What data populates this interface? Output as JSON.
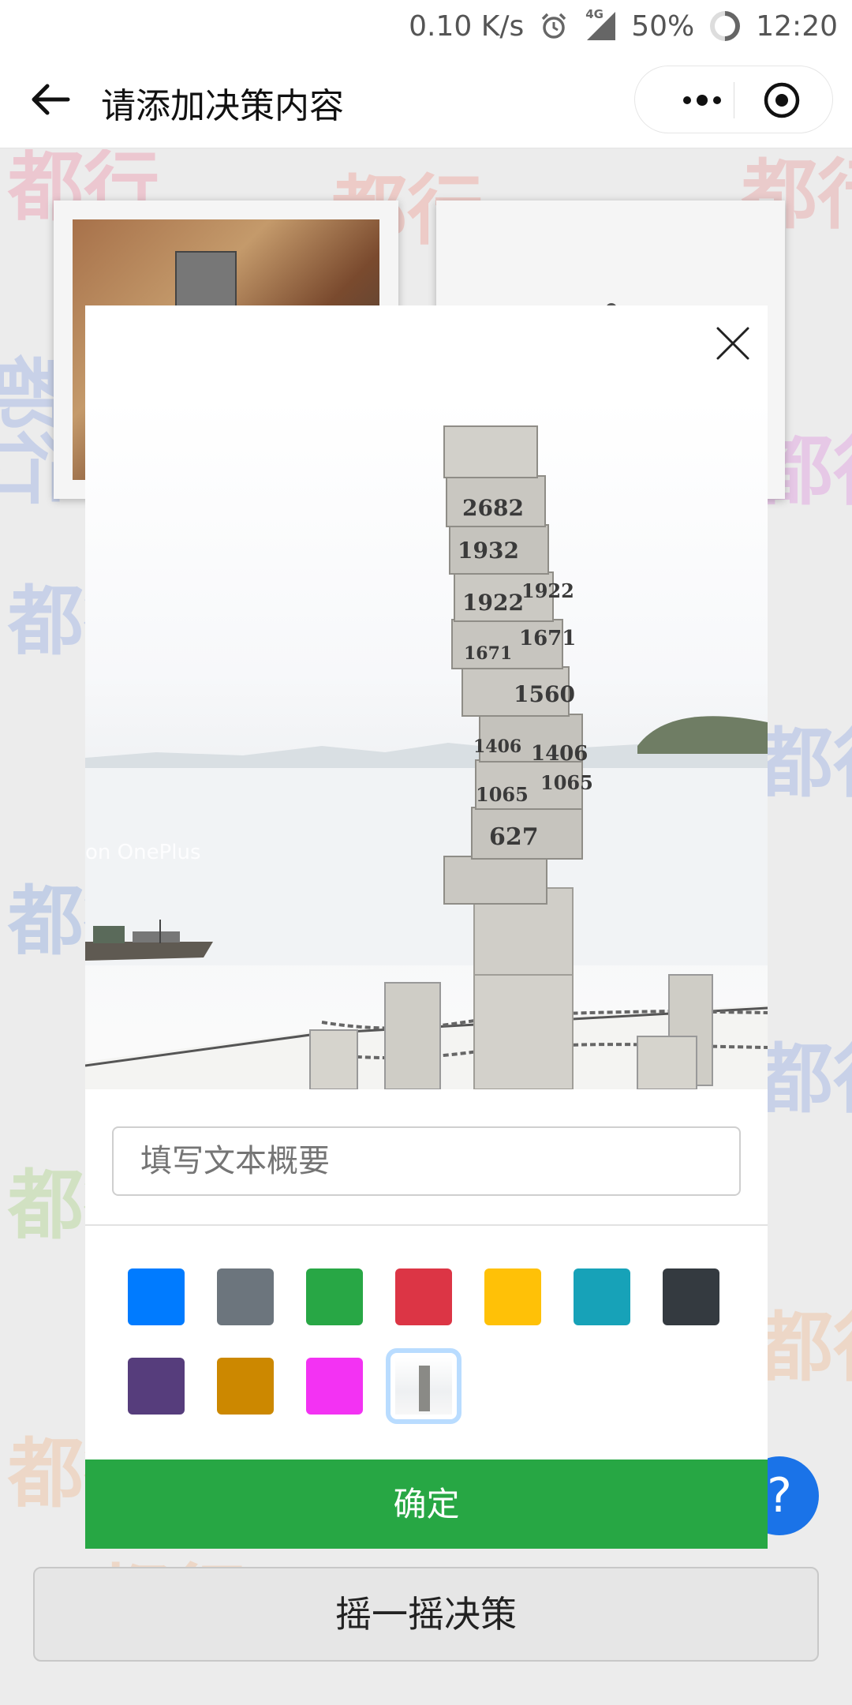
{
  "status_bar": {
    "speed": "0.10 K/s",
    "network": "4G",
    "battery": "50%",
    "time": "12:20"
  },
  "nav": {
    "title": "请添加决策内容"
  },
  "background": {
    "watermarks": [
      "都行",
      "都行",
      "都行",
      "都行",
      "都行",
      "都行",
      "都行",
      "都行",
      "都行",
      "都行",
      "都行",
      "都行",
      "都行",
      "都行"
    ]
  },
  "modal": {
    "photo": {
      "markers": [
        "2682",
        "1932",
        "1922",
        "1922",
        "1671",
        "1671",
        "1560",
        "1406",
        "1406",
        "1065",
        "1065",
        "627"
      ],
      "watermark": "on OnePlus"
    },
    "summary_placeholder": "填写文本概要",
    "swatches": [
      "#007bff",
      "#6c757d",
      "#28a745",
      "#dc3545",
      "#ffc107",
      "#17a2b8",
      "#343a40",
      "#563d7c",
      "#cc8800",
      "#f332f3"
    ],
    "confirm_label": "确定"
  },
  "help_label": "?",
  "shake_label": "摇一摇决策"
}
